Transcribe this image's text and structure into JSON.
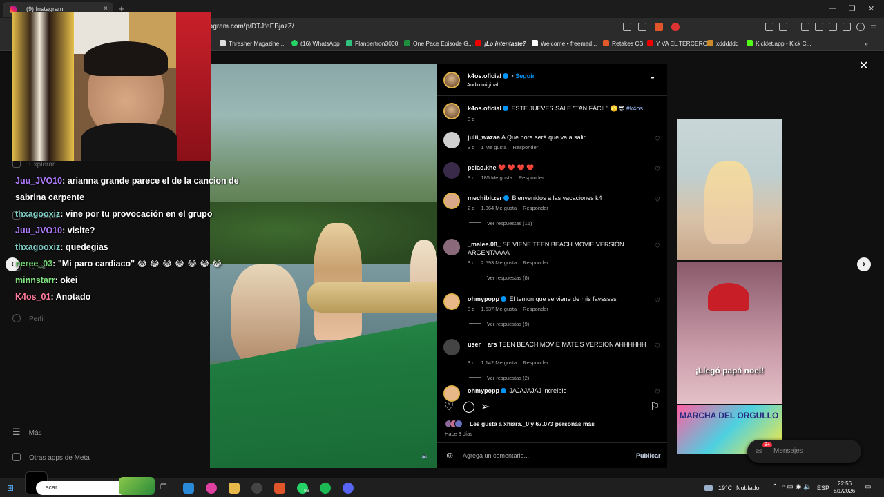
{
  "browser": {
    "tab_title": "(9) Instagram",
    "tab_close": "×",
    "new_tab": "+",
    "url": "tagram.com/p/DTJfeEBjazZ/",
    "bookmarks": [
      "Thrasher Magazine...",
      "(16) WhatsApp",
      "Flandertron3000",
      "One Pace Episode G...",
      "¡Lo intentaste?",
      "Welcome • freemed...",
      "Retakes CS",
      "Y VA EL TERCERO",
      "xdddddd",
      "Kicklet.app - Kick C..."
    ],
    "bookmarks_more": "»"
  },
  "instagram_nav": {
    "explore": "Explorar",
    "messages": "Mensajes",
    "create": "Crear",
    "profile": "Perfil",
    "more": "Más",
    "meta_apps": "Otras apps de Meta"
  },
  "chat": [
    {
      "user": "Juu_JVO10",
      "color": "#b07cff",
      "message": ": arianna grande parece el de la cancion de"
    },
    {
      "user": "",
      "color": "#ffffff",
      "message": "sabrina carpente"
    },
    {
      "user": "thxagooxiz",
      "color": "#7fd0c8",
      "message": ": vine por tu provocación en el grupo"
    },
    {
      "user": "Juu_JVO10",
      "color": "#b07cff",
      "message": ": visite?"
    },
    {
      "user": "thxagooxiz",
      "color": "#7fd0c8",
      "message": ": quedegias"
    },
    {
      "user": "neree_03",
      "color": "#6fd46f",
      "message": ": \"Mi paro cardiaco\" 😂 😂 😂 😂 😂 😂 😂"
    },
    {
      "user": "minnstarr",
      "color": "#7fe07f",
      "message": ": okei"
    },
    {
      "user": "K4os_01",
      "color": "#ff7a9a",
      "message": ": Anotado"
    }
  ],
  "post": {
    "author": "k4os.oficial",
    "follow": "Seguir",
    "dot": "•",
    "audio": "Audio original",
    "more": "•••",
    "caption": "ESTE JUEVES SALE \"TAN FÁCIL\" 🫣😎",
    "hashtag": "#k4os",
    "caption_time": "3 d",
    "likes_text": "Les gusta a xhiara._0 y 67.073 personas más",
    "posted_ago": "Hace 3 días",
    "comment_placeholder": "Agrega un comentario...",
    "publish": "Publicar",
    "close": "✕"
  },
  "comments": [
    {
      "user": "julii_wazaa",
      "verified": false,
      "text": "A Que hora será que va a salir",
      "time": "3 d",
      "likes": "1 Me gusta",
      "reply": "Responder",
      "replies": ""
    },
    {
      "user": "pelao.khe",
      "verified": false,
      "text": "❤️ ❤️ ❤️ ❤️",
      "time": "3 d",
      "likes": "185 Me gusta",
      "reply": "Responder",
      "replies": ""
    },
    {
      "user": "mechibitzer",
      "verified": true,
      "text": "Bienvenidos a las vacaciones k4",
      "time": "2 d",
      "likes": "1.364 Me gusta",
      "reply": "Responder",
      "replies": "Ver respuestas (16)"
    },
    {
      "user": "_malee.08_",
      "verified": false,
      "text": "SE VIENE TEEN BEACH MOVIE VERSIÓN ARGENTAAAA",
      "time": "3 d",
      "likes": "2.593 Me gusta",
      "reply": "Responder",
      "replies": "Ver respuestas (8)"
    },
    {
      "user": "ohmypopp",
      "verified": true,
      "text": "El temon que se viene de mis favsssss",
      "time": "3 d",
      "likes": "1.537 Me gusta",
      "reply": "Responder",
      "replies": "Ver respuestas (9)"
    },
    {
      "user": "user__ars",
      "verified": false,
      "text": "TEEN BEACH MOVIE MATE'S VERSION AHHHHHH",
      "time": "3 d",
      "likes": "1.142 Me gusta",
      "reply": "Responder",
      "replies": "Ver respuestas (2)"
    },
    {
      "user": "ohmypopp",
      "verified": true,
      "text": "JAJAJAJAJ increíble",
      "time": "",
      "likes": "",
      "reply": "",
      "replies": ""
    }
  ],
  "explore": {
    "tile_caption": "¡Llegó papá noel!",
    "tile_title": "MARCHA DEL ORGULLO",
    "messages_pill": "Mensajes",
    "messages_badge": "9+"
  },
  "taskbar": {
    "search": "scar",
    "whatsapp_badge": "88",
    "weather": "19°C",
    "weather_desc": "Nublado",
    "lang": "ESP",
    "time": "22:56",
    "date": "8/1/2026"
  },
  "colors": {
    "instagram_blue": "#0095f6",
    "ring": "#e0b34a",
    "page_bg": "#101010"
  }
}
